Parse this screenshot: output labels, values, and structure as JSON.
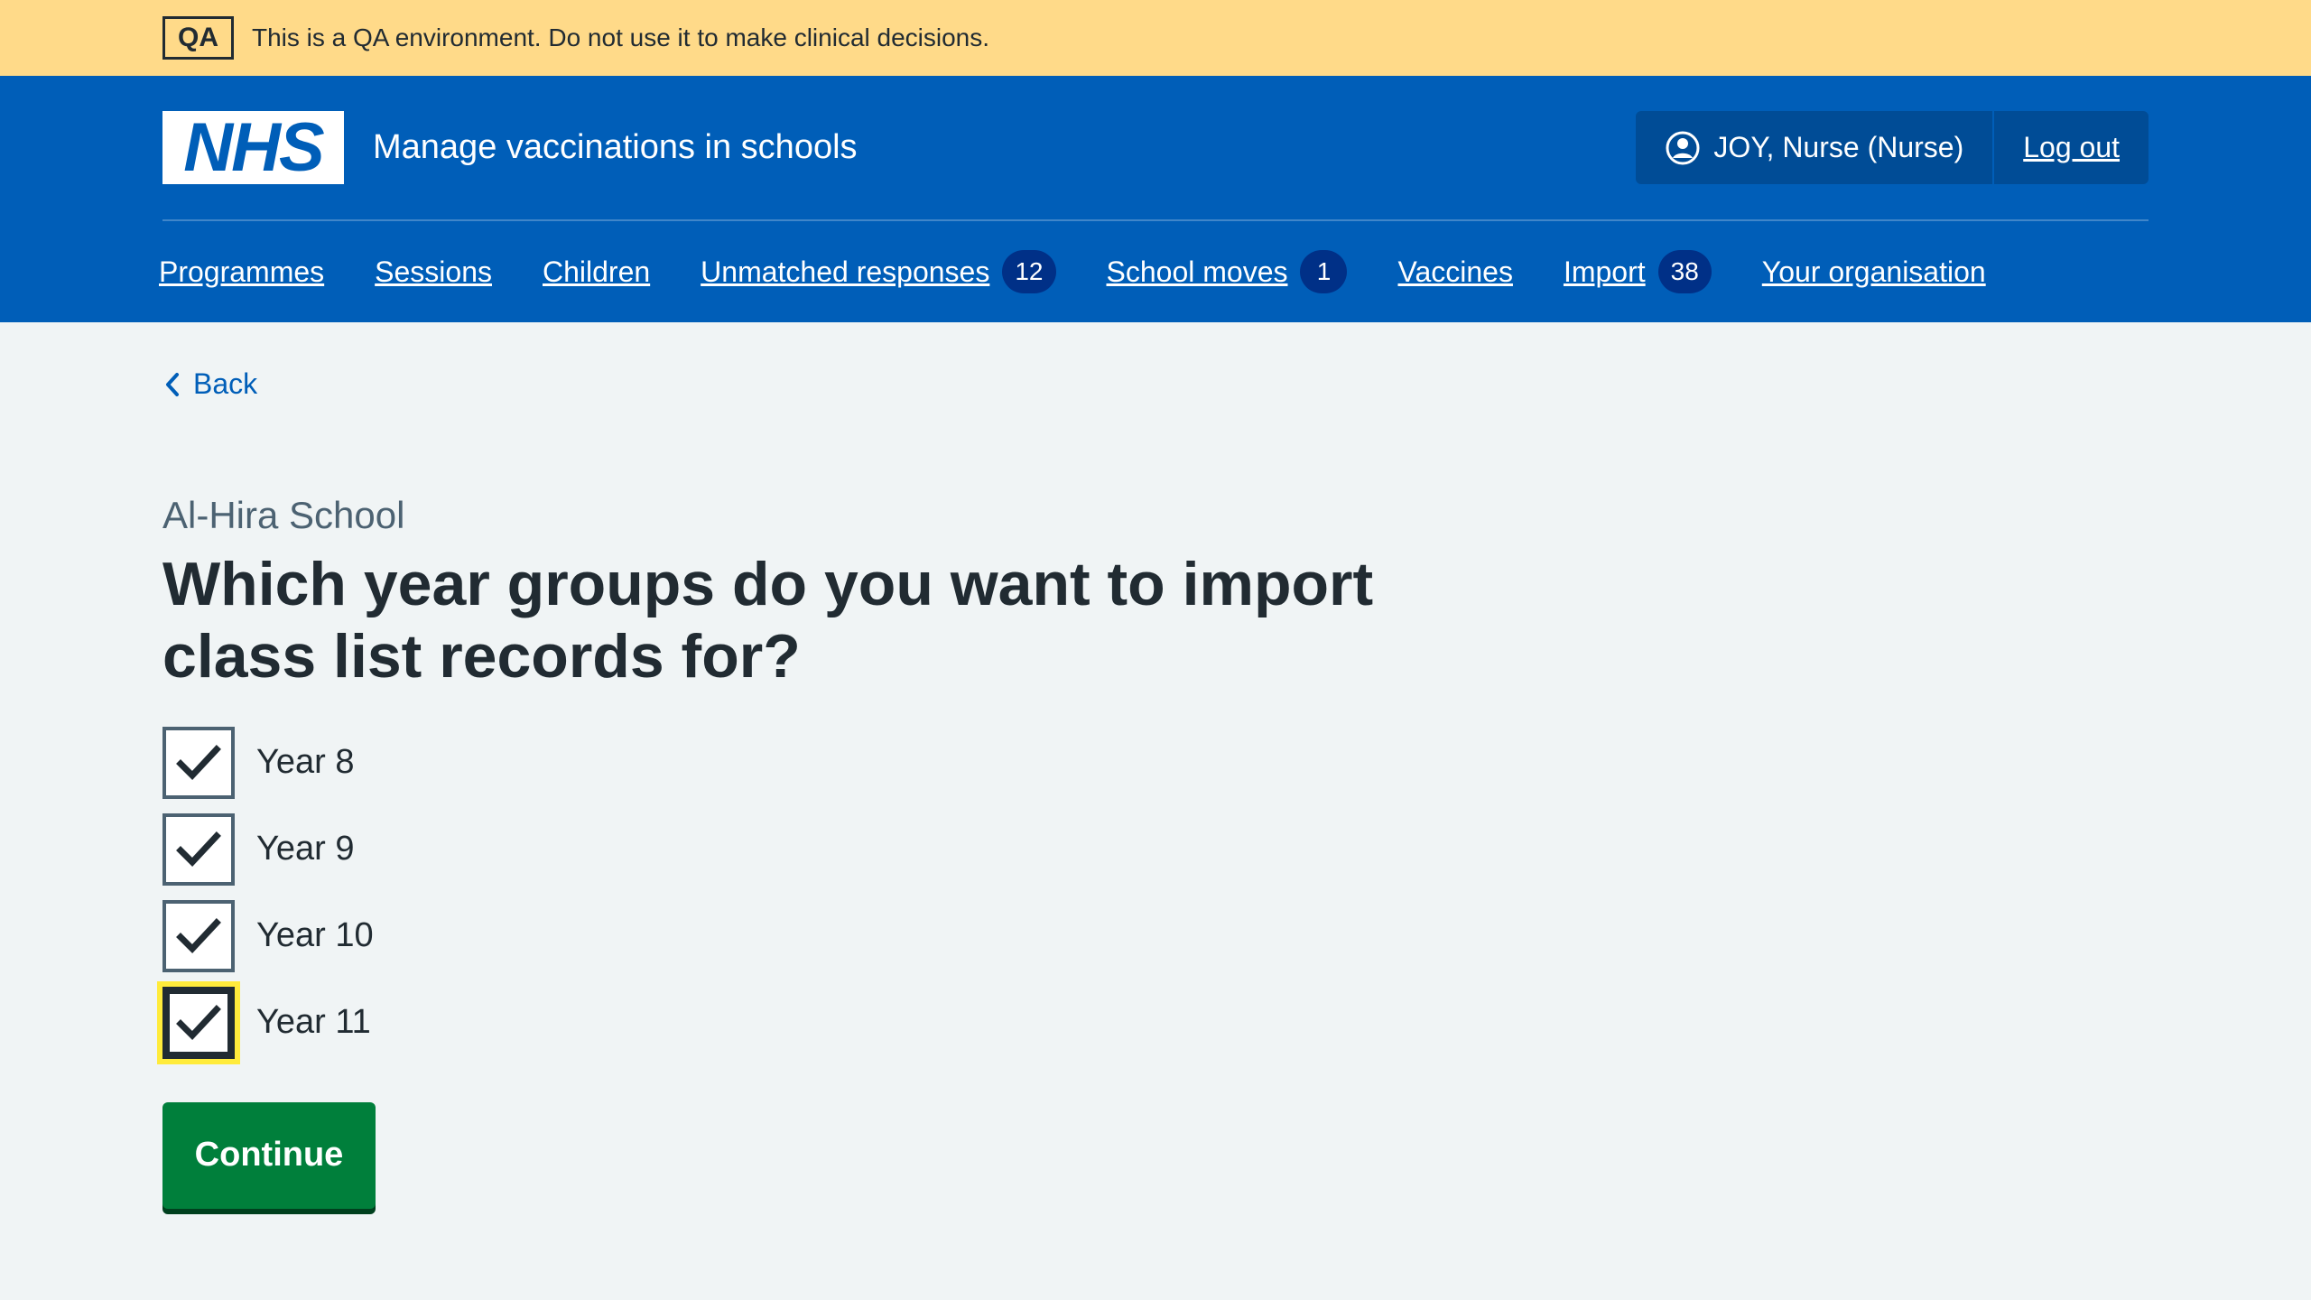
{
  "environment": {
    "tag": "QA",
    "message": "This is a QA environment. Do not use it to make clinical decisions."
  },
  "header": {
    "logo_text": "NHS",
    "service_name": "Manage vaccinations in schools",
    "user": "JOY, Nurse (Nurse)",
    "logout": "Log out"
  },
  "nav": {
    "items": [
      {
        "label": "Programmes"
      },
      {
        "label": "Sessions"
      },
      {
        "label": "Children"
      },
      {
        "label": "Unmatched responses",
        "count": "12"
      },
      {
        "label": "School moves",
        "count": "1"
      },
      {
        "label": "Vaccines"
      },
      {
        "label": "Import",
        "count": "38"
      },
      {
        "label": "Your organisation"
      }
    ]
  },
  "page": {
    "back": "Back",
    "caption": "Al-Hira School",
    "heading": "Which year groups do you want to import class list records for?",
    "options": [
      {
        "label": "Year 8",
        "checked": true
      },
      {
        "label": "Year 9",
        "checked": true
      },
      {
        "label": "Year 10",
        "checked": true
      },
      {
        "label": "Year 11",
        "checked": true
      }
    ],
    "continue": "Continue"
  },
  "colors": {
    "nhs_blue": "#005eb8",
    "banner_yellow": "#ffda89",
    "continue_green": "#007f3b",
    "focus_yellow": "#ffeb3b"
  }
}
